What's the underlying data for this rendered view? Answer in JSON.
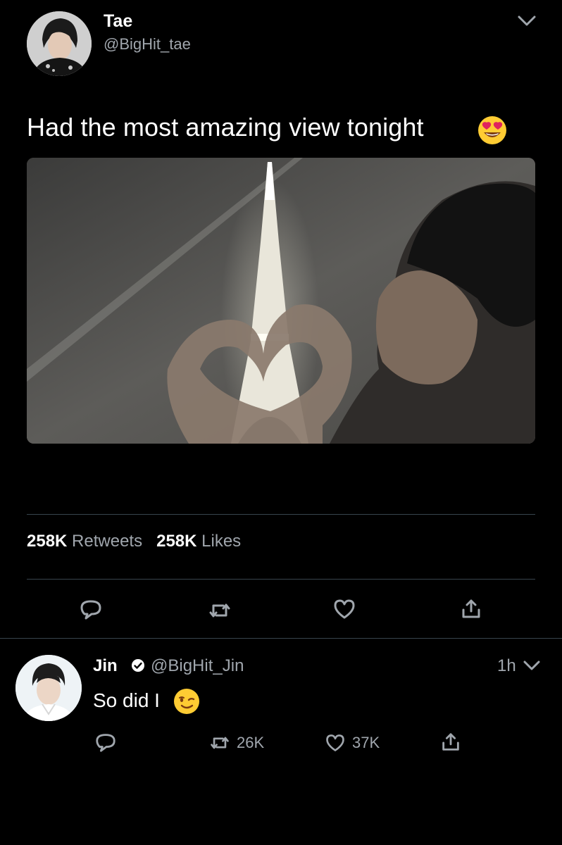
{
  "tweet": {
    "author_name": "Tae",
    "author_handle": "@BigHit_tae",
    "text": "Had the most amazing view tonight",
    "emoji_icon": "heart-eyes-emoji-icon",
    "photo_icon": "eiffel-tower-heart-hands-photo",
    "stats": {
      "retweets_count": "258K",
      "retweets_label": "Retweets",
      "likes_count": "258K",
      "likes_label": "Likes"
    },
    "actions": [
      "reply-icon",
      "retweet-icon",
      "like-icon",
      "share-icon"
    ]
  },
  "reply": {
    "author_name": "Jin",
    "author_handle": "@BigHit_Jin",
    "time": "1h",
    "text": "So did I",
    "emoji_icon": "winking-face-emoji-icon",
    "retweets_count": "26K",
    "likes_count": "37K"
  },
  "colors": {
    "background": "#000000",
    "text": "#ffffff",
    "muted": "#a0a6ad",
    "divider": "#38444d"
  }
}
